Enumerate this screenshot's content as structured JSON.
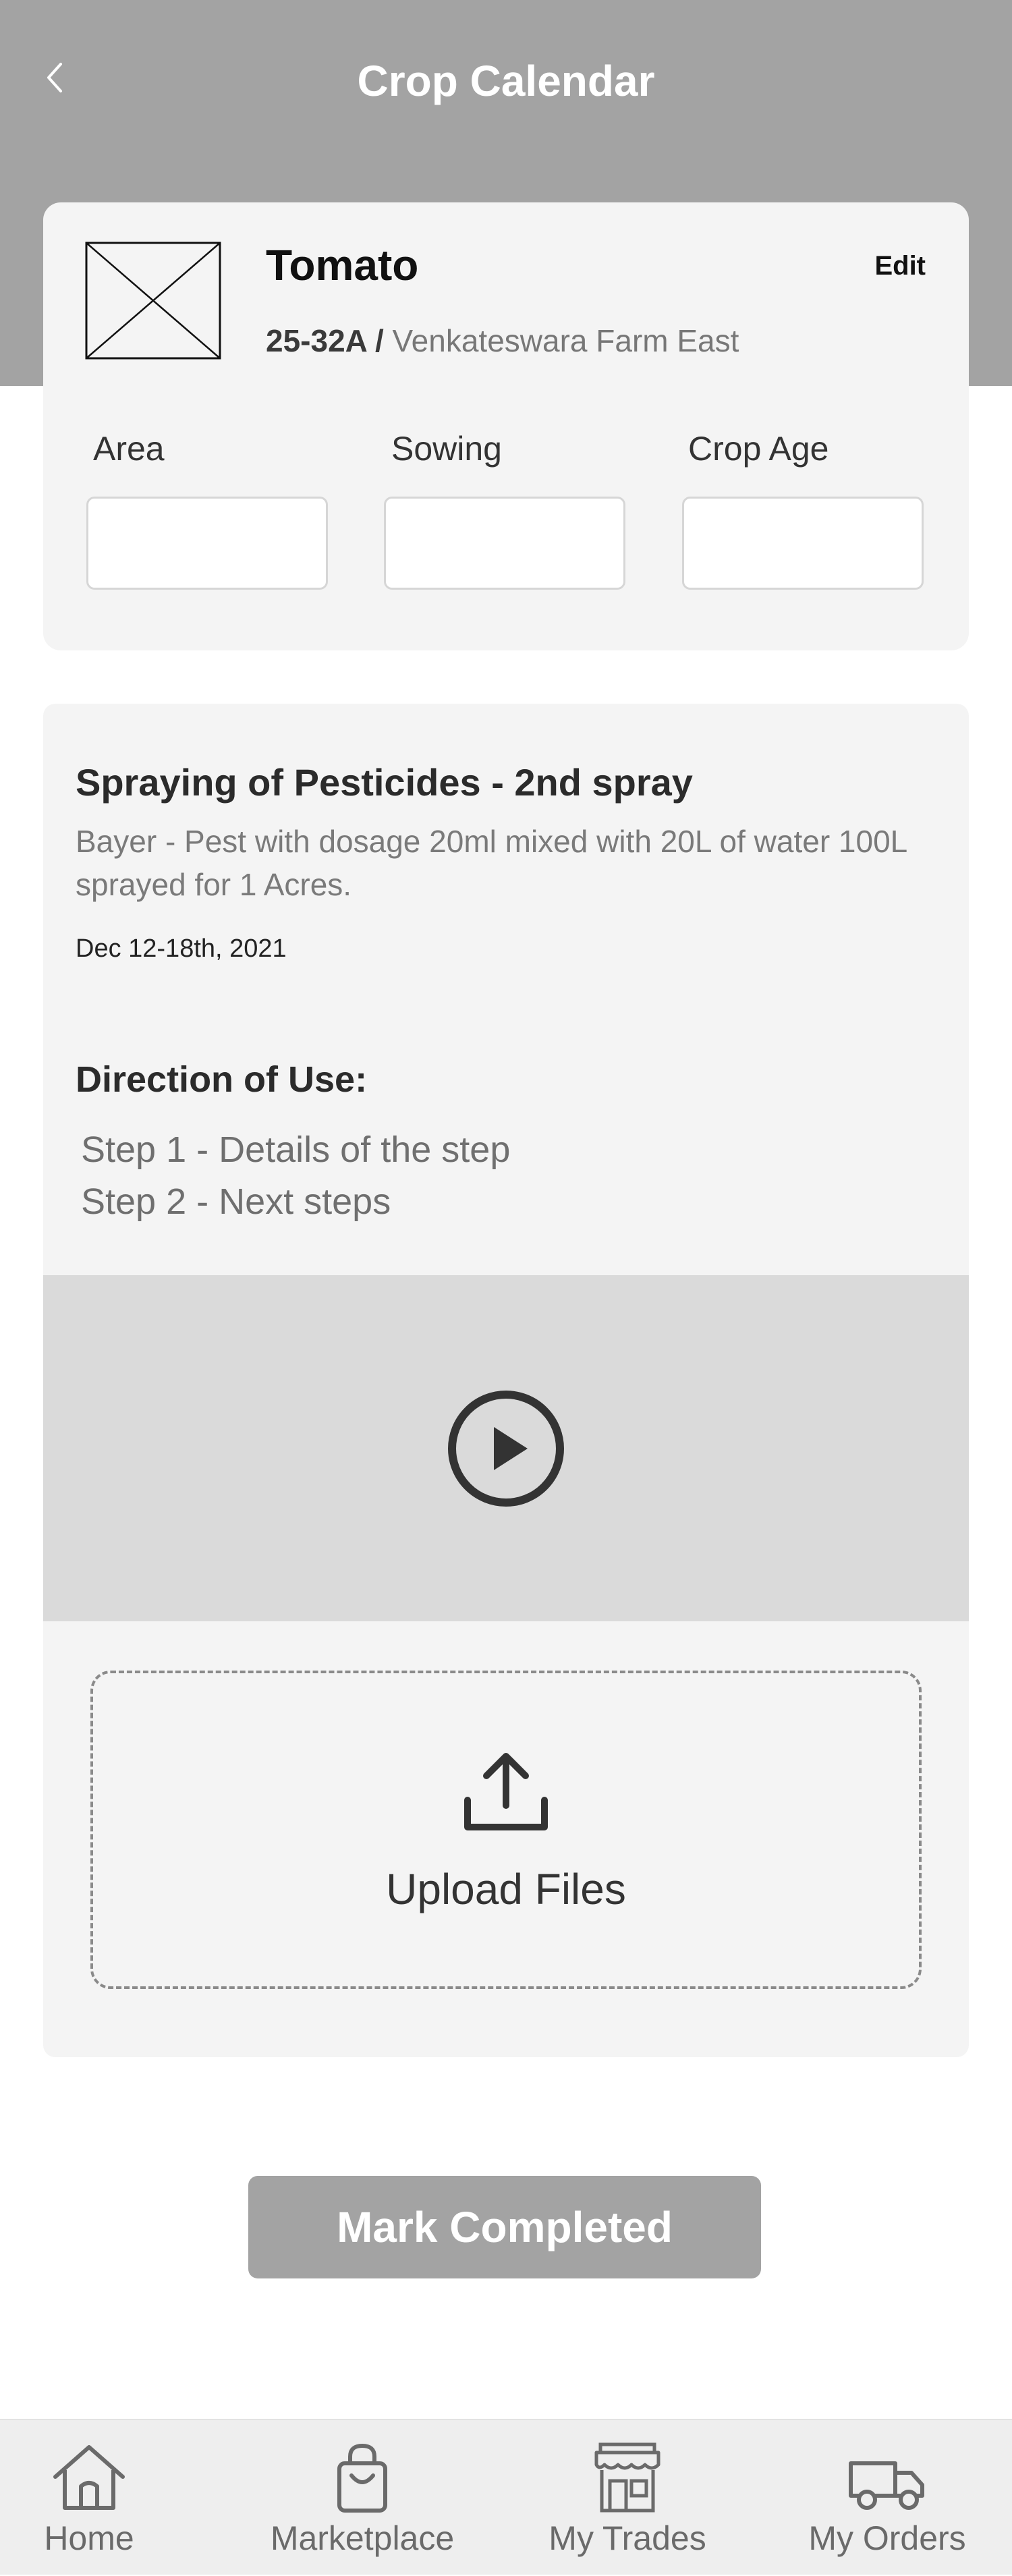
{
  "header": {
    "title": "Crop Calendar",
    "back_icon": "chevron-left-icon"
  },
  "crop": {
    "name": "Tomato",
    "edit_label": "Edit",
    "plot_code": "25-32A /",
    "farm_name": "Venkateswara Farm East",
    "thumbnail": "image-placeholder-icon",
    "fields": [
      {
        "label": "Area",
        "value": ""
      },
      {
        "label": "Sowing",
        "value": ""
      },
      {
        "label": "Crop Age",
        "value": ""
      }
    ]
  },
  "task": {
    "title": "Spraying of Pesticides - 2nd spray",
    "description": "Bayer - Pest with dosage 20ml mixed with 20L of water 100L sprayed for 1 Acres.",
    "date": "Dec 12-18th, 2021",
    "direction_title": "Direction of Use:",
    "steps": [
      "Step 1 - Details of the step",
      "Step 2 - Next steps"
    ],
    "video_icon": "play-circle-icon",
    "upload_label": "Upload Files",
    "upload_icon": "upload-icon"
  },
  "actions": {
    "mark_completed": "Mark Completed"
  },
  "bottom_nav": [
    {
      "label": "Home",
      "icon": "home-icon"
    },
    {
      "label": "Marketplace",
      "icon": "shopping-bag-icon"
    },
    {
      "label": "My Trades",
      "icon": "store-icon"
    },
    {
      "label": "My Orders",
      "icon": "truck-icon"
    }
  ],
  "colors": {
    "header_bg": "#a3a3a3",
    "card_bg": "#f4f4f4",
    "video_bg": "#dadada",
    "button_bg": "#a3a3a3",
    "nav_bg": "#eeeeee"
  }
}
